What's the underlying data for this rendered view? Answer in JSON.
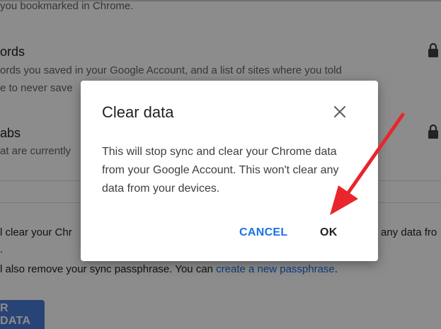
{
  "background": {
    "line1": "you bookmarked in Chrome.",
    "passwords_title": "ords",
    "passwords_desc1": "ords you saved in your Google Account, and a list of sites where you told",
    "passwords_desc2": "e to never save",
    "tabs_title": "abs",
    "tabs_desc": "at are currently",
    "clear_text_left": "l clear your Chr",
    "clear_text_right": "any data fro",
    "clear_text_dot": ".",
    "passphrase_text": "l also remove your sync passphrase. You can ",
    "passphrase_link": "create a new passphrase",
    "passphrase_end": ".",
    "clear_button": "R DATA"
  },
  "dialog": {
    "title": "Clear data",
    "body": "This will stop sync and clear your Chrome data from your Google Account. This won't clear any data from your devices.",
    "cancel_label": "CANCEL",
    "ok_label": "OK"
  },
  "icons": {
    "lock": "lock-icon",
    "close": "close-icon",
    "arrow": "red-arrow-annotation"
  },
  "colors": {
    "accent": "#1a73e8",
    "button_bg": "#4a7bd6",
    "arrow": "#e8262b"
  }
}
